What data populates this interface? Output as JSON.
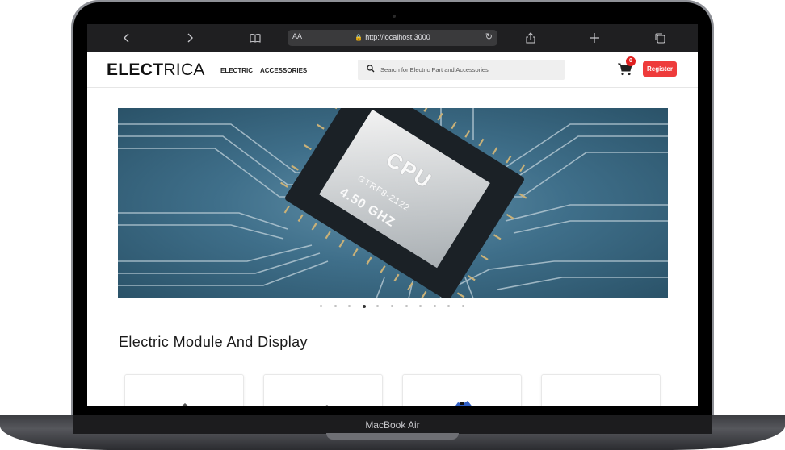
{
  "device": {
    "model_label": "MacBook Air"
  },
  "browser": {
    "aa_label": "AA",
    "url": "http://localhost:3000",
    "icons": [
      "chevron-left-icon",
      "chevron-right-icon",
      "book-icon",
      "lock-icon",
      "reload-icon",
      "share-icon",
      "plus-icon",
      "tabs-icon"
    ]
  },
  "header": {
    "logo_bold": "ELECT",
    "logo_light": "RICA",
    "nav": [
      {
        "label": "ELECTRIC"
      },
      {
        "label": "ACCESSORIES"
      }
    ],
    "search_placeholder": "Search for Electric Part and Accessories",
    "cart_count": "0",
    "register_label": "Register"
  },
  "hero": {
    "chip_title": "CPU",
    "chip_model": "GTRF8-2122",
    "chip_speed": "4.50 GHZ",
    "slide_count": 11,
    "active_slide": 4
  },
  "section": {
    "title": "Electric Module And Display"
  },
  "products": [
    {},
    {},
    {},
    {}
  ],
  "colors": {
    "accent": "#ee3b3b",
    "badge": "#e02020",
    "hero_blue": "#3f6f8a"
  }
}
